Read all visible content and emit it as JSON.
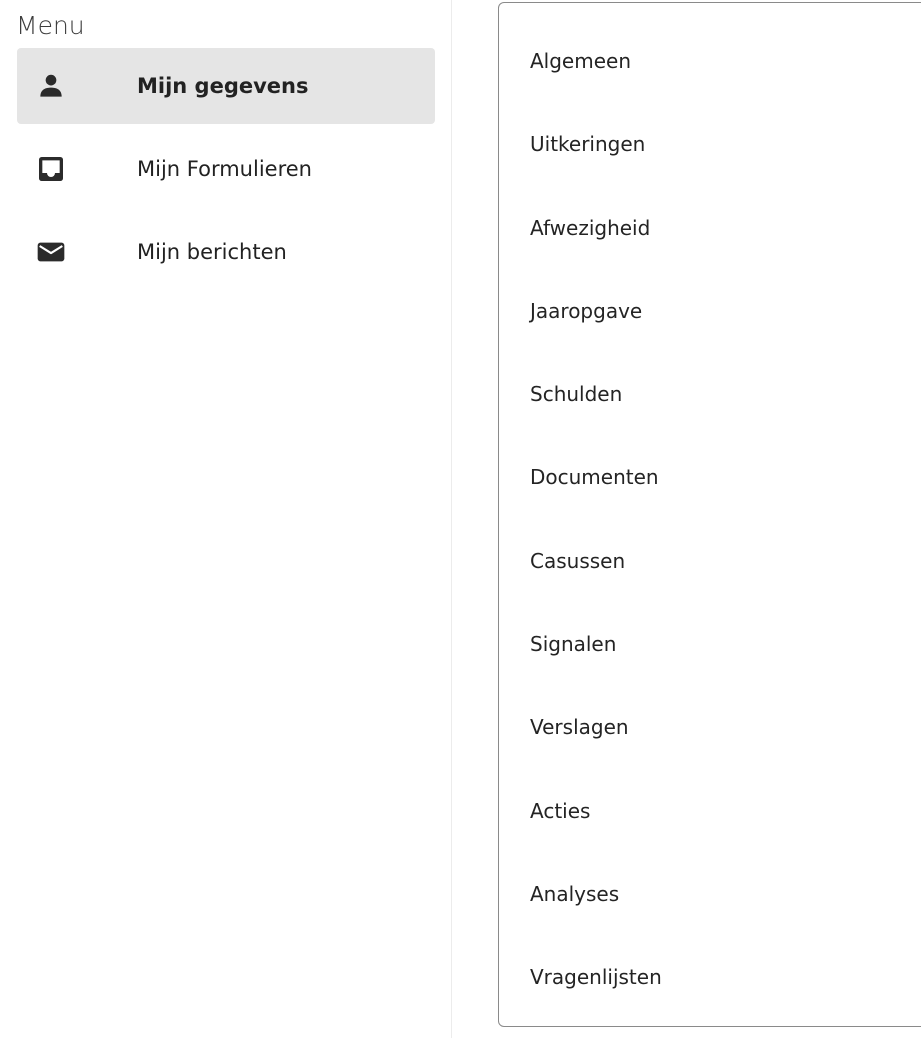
{
  "menu": {
    "heading": "Menu",
    "items": [
      {
        "label": "Mijn gegevens",
        "icon": "person-icon",
        "active": true
      },
      {
        "label": "Mijn Formulieren",
        "icon": "inbox-icon",
        "active": false
      },
      {
        "label": "Mijn berichten",
        "icon": "mail-icon",
        "active": false
      }
    ]
  },
  "submenu": {
    "items": [
      {
        "label": "Algemeen"
      },
      {
        "label": "Uitkeringen"
      },
      {
        "label": "Afwezigheid"
      },
      {
        "label": "Jaaropgave"
      },
      {
        "label": "Schulden"
      },
      {
        "label": "Documenten"
      },
      {
        "label": "Casussen"
      },
      {
        "label": "Signalen"
      },
      {
        "label": "Verslagen"
      },
      {
        "label": "Acties"
      },
      {
        "label": "Analyses"
      },
      {
        "label": "Vragenlijsten"
      }
    ]
  },
  "colors": {
    "active_background": "#e5e5e5",
    "icon": "#2b2b2b",
    "text": "#222222",
    "panel_border": "#8a8a8a"
  }
}
